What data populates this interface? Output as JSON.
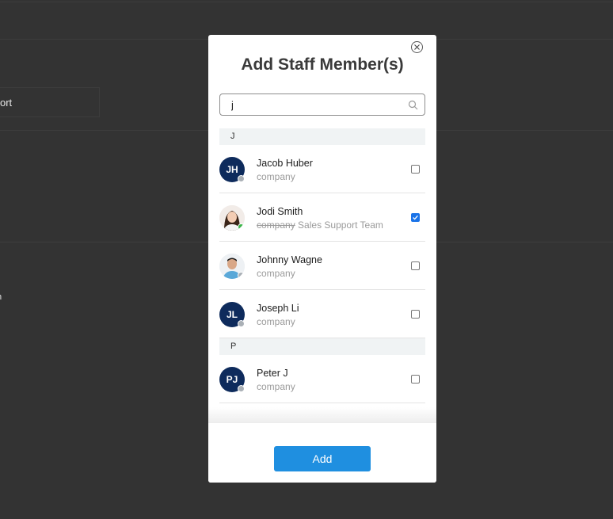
{
  "background": {
    "partial_text_1": "ort",
    "partial_text_2": "n"
  },
  "modal": {
    "title": "Add Staff Member(s)",
    "close_icon": "close-icon",
    "search": {
      "value": "j",
      "placeholder": "",
      "icon": "search-icon"
    },
    "groups": [
      {
        "letter": "J",
        "members": [
          {
            "initials": "JH",
            "name": "Jacob Huber",
            "company": "company",
            "team": "",
            "status": "offline",
            "checked": false,
            "photo": false
          },
          {
            "initials": "",
            "name": "Jodi Smith",
            "company": "company",
            "team": "Sales Support Team",
            "status": "online",
            "checked": true,
            "photo": true
          },
          {
            "initials": "",
            "name": "Johnny Wagne",
            "company": "company",
            "team": "",
            "status": "offline",
            "checked": false,
            "photo": true
          },
          {
            "initials": "JL",
            "name": "Joseph Li",
            "company": "company",
            "team": "",
            "status": "offline",
            "checked": false,
            "photo": false
          }
        ]
      },
      {
        "letter": "P",
        "members": [
          {
            "initials": "PJ",
            "name": "Peter J",
            "company": "company",
            "team": "",
            "status": "offline",
            "checked": false,
            "photo": false
          }
        ]
      }
    ],
    "add_button": "Add"
  },
  "colors": {
    "accent": "#1f8fe0",
    "avatar_bg": "#0e2b5c",
    "online": "#3ab54a",
    "offline": "#aab0b6",
    "overlay": "#333333"
  }
}
